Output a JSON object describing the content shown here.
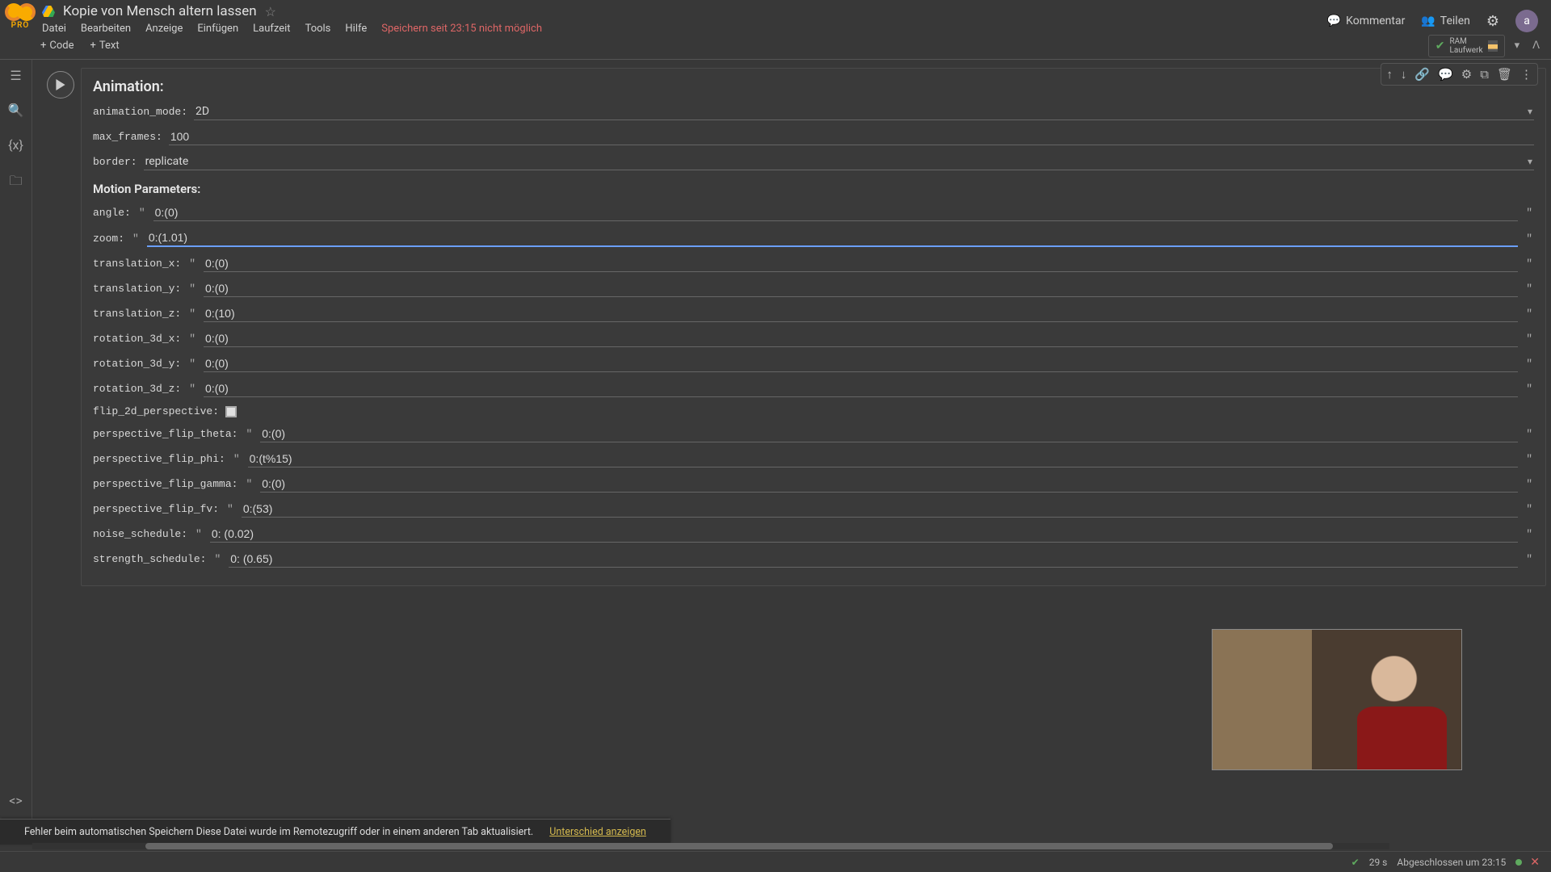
{
  "header": {
    "pro": "PRO",
    "title": "Kopie von Mensch altern lassen",
    "menus": [
      "Datei",
      "Bearbeiten",
      "Anzeige",
      "Einfügen",
      "Laufzeit",
      "Tools",
      "Hilfe"
    ],
    "save_error": "Speichern seit 23:15 nicht möglich",
    "comment": "Kommentar",
    "share": "Teilen",
    "avatar": "a"
  },
  "toolbar": {
    "code": "Code",
    "text": "Text",
    "ram": "RAM",
    "disk": "Laufwerk"
  },
  "cell": {
    "section_animation": "Animation:",
    "section_motion": "Motion Parameters:",
    "fields": {
      "animation_mode": {
        "label": "animation_mode:",
        "value": "2D",
        "type": "select"
      },
      "max_frames": {
        "label": "max_frames:",
        "value": "100",
        "type": "text"
      },
      "border": {
        "label": "border:",
        "value": "replicate",
        "type": "select"
      },
      "angle": {
        "label": "angle:",
        "value": "0:(0)",
        "type": "string"
      },
      "zoom": {
        "label": "zoom:",
        "value": "0:(1.01)",
        "type": "string",
        "focused": true
      },
      "translation_x": {
        "label": "translation_x:",
        "value": "0:(0)",
        "type": "string"
      },
      "translation_y": {
        "label": "translation_y:",
        "value": "0:(0)",
        "type": "string"
      },
      "translation_z": {
        "label": "translation_z:",
        "value": "0:(10)",
        "type": "string"
      },
      "rotation_3d_x": {
        "label": "rotation_3d_x:",
        "value": "0:(0)",
        "type": "string"
      },
      "rotation_3d_y": {
        "label": "rotation_3d_y:",
        "value": "0:(0)",
        "type": "string"
      },
      "rotation_3d_z": {
        "label": "rotation_3d_z:",
        "value": "0:(0)",
        "type": "string"
      },
      "flip_2d_perspective": {
        "label": "flip_2d_perspective:",
        "type": "checkbox"
      },
      "perspective_flip_theta": {
        "label": "perspective_flip_theta:",
        "value": "0:(0)",
        "type": "string"
      },
      "perspective_flip_phi": {
        "label": "perspective_flip_phi:",
        "value": "0:(t%15)",
        "type": "string"
      },
      "perspective_flip_gamma": {
        "label": "perspective_flip_gamma:",
        "value": "0:(0)",
        "type": "string"
      },
      "perspective_flip_fv": {
        "label": "perspective_flip_fv:",
        "value": "0:(53)",
        "type": "string"
      },
      "noise_schedule": {
        "label": "noise_schedule:",
        "value": "0: (0.02)",
        "type": "string"
      },
      "strength_schedule": {
        "label": "strength_schedule:",
        "value": "0: (0.65)",
        "type": "string"
      }
    }
  },
  "error_banner": {
    "text": "Fehler beim automatischen Speichern Diese Datei wurde im Remotezugriff oder in einem anderen Tab aktualisiert.",
    "link": "Unterschied anzeigen"
  },
  "status": {
    "seconds": "29 s",
    "done": "Abgeschlossen um 23:15"
  }
}
